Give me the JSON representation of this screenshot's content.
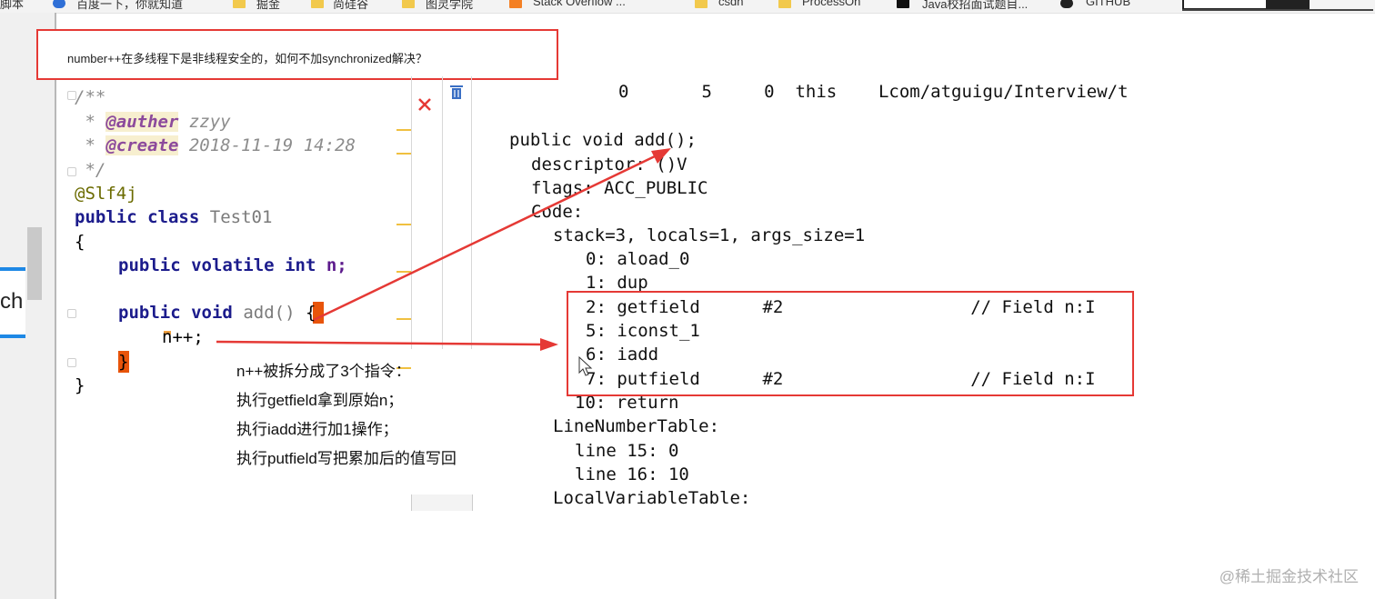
{
  "bookmarks": [
    {
      "label": "脚本"
    },
    {
      "label": "百度一下，你就知道"
    },
    {
      "label": "掘金"
    },
    {
      "label": "尚硅谷"
    },
    {
      "label": "图灵学院"
    },
    {
      "label": "Stack Overflow ..."
    },
    {
      "label": "csdn"
    },
    {
      "label": "ProcessOn"
    },
    {
      "label": "Java校招面试题目..."
    },
    {
      "label": "GITHUB"
    }
  ],
  "left_tab_label": "ch",
  "question": "number++在多线程下是非线程安全的，如何不加synchronized解决？",
  "editor": {
    "doc_open": "/**",
    "auther_tag": "@auther",
    "auther_value": "zzyy",
    "create_tag": "@create",
    "create_value": "2018-11-19 14:28",
    "doc_close": "*/",
    "annotation": "@Slf4j",
    "kw_public": "public",
    "kw_class": "class",
    "class_name": "Test01",
    "brace_open": "{",
    "kw_volatile": "volatile",
    "kw_int": "int",
    "field_decl": "n;",
    "kw_void": "void",
    "method_decl": "add()",
    "body_line": "n++;",
    "brace_close": "}"
  },
  "explanation": [
    "n++被拆分成了3个指令：",
    "执行getfield拿到原始n；",
    "执行iadd进行加1操作；",
    "执行putfield写把累加后的值写回"
  ],
  "bytecode": {
    "local_var_row": "0       5     0  this    Lcom/atguigu/Interview/t",
    "method_sig": "public void add();",
    "descriptor": "descriptor: ()V",
    "flags": "flags: ACC_PUBLIC",
    "code_label": "Code:",
    "stack_info": "stack=3, locals=1, args_size=1",
    "instructions": [
      "0: aload_0",
      "1: dup",
      "2: getfield      #2                  // Field n:I",
      "5: iconst_1",
      "6: iadd",
      "7: putfield      #2                  // Field n:I",
      "10: return"
    ],
    "line_table_label": "LineNumberTable:",
    "line_entries": [
      "line 15: 0",
      "line 16: 10"
    ],
    "local_var_table_label": "LocalVariableTable:"
  },
  "watermark": "@稀土掘金技术社区",
  "colors": {
    "highlight": "#e53935",
    "accent": "#1e88e5",
    "keyword": "#1c1c8c",
    "field": "#5c1a8c"
  }
}
